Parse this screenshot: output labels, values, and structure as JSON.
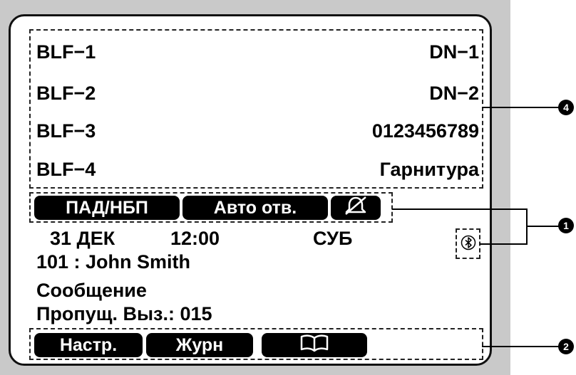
{
  "display": {
    "blf_rows": [
      {
        "left": "BLF−1",
        "right": "DN−1"
      },
      {
        "left": "BLF−2",
        "right": "DN−2"
      },
      {
        "left": "BLF−3",
        "right": "0123456789"
      },
      {
        "left": "BLF−4",
        "right": "Гарнитура"
      }
    ],
    "status_buttons": {
      "button1": "ПАД/НБП",
      "button2": "Авто отв.",
      "button3_icon": "bell-muted-icon"
    },
    "datetime": {
      "date": "31 ДЕК",
      "time": "12:00",
      "day": "СУБ"
    },
    "bluetooth_icon": "bluetooth-icon",
    "user_line": "101 : John Smith",
    "message_line": "Сообщение",
    "missed_calls": "Пропущ. Выз.: 015",
    "softkeys": {
      "key1": "Настр.",
      "key2": "Журн",
      "key3_icon": "book-icon"
    }
  },
  "callouts": [
    "4",
    "1",
    "2"
  ]
}
